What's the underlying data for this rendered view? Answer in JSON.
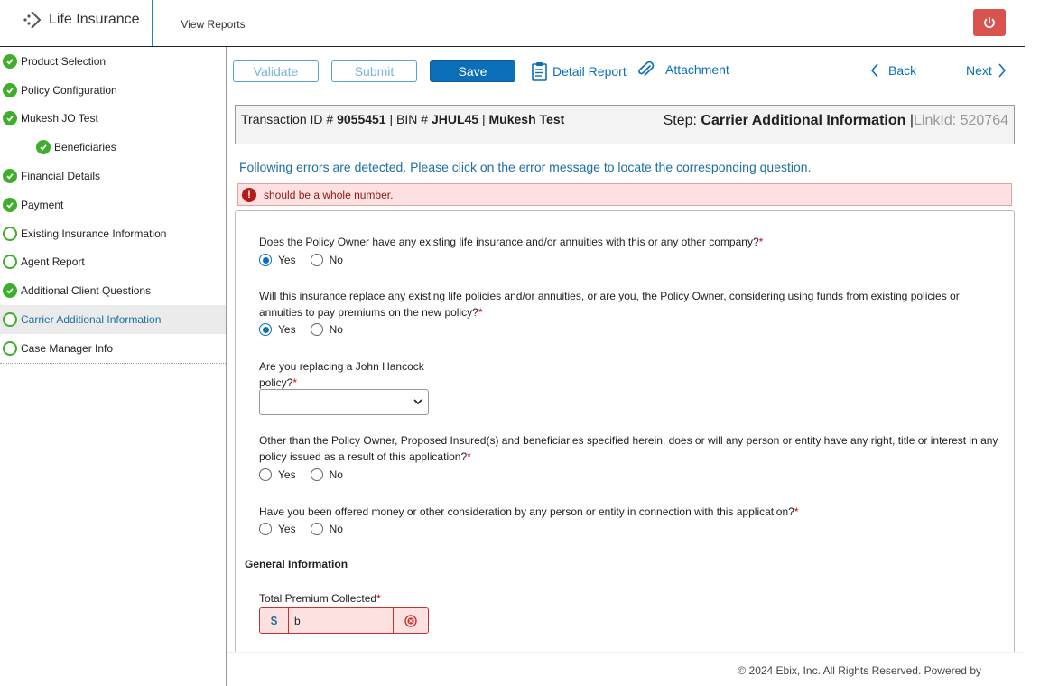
{
  "header": {
    "app_name": "Life Insurance",
    "view_reports": "View Reports",
    "power_icon": "power-icon",
    "accent_color": "#d9534f"
  },
  "sidebar": {
    "items": [
      {
        "label": "Product Selection",
        "status": "done"
      },
      {
        "label": "Policy Configuration",
        "status": "done"
      },
      {
        "label": "Mukesh JO Test",
        "status": "done"
      },
      {
        "label": "Beneficiaries",
        "status": "done",
        "sub": true
      },
      {
        "label": "Financial Details",
        "status": "done"
      },
      {
        "label": "Payment",
        "status": "done"
      },
      {
        "label": "Existing Insurance Information",
        "status": "pending"
      },
      {
        "label": "Agent Report",
        "status": "pending"
      },
      {
        "label": "Additional Client Questions",
        "status": "done"
      },
      {
        "label": "Carrier Additional Information",
        "status": "pending",
        "active": true
      },
      {
        "label": "Case Manager Info",
        "status": "pending"
      }
    ]
  },
  "toolbar": {
    "validate": "Validate",
    "submit": "Submit",
    "save": "Save",
    "detail_report": "Detail Report",
    "attachment": "Attachment",
    "back": "Back",
    "next": "Next"
  },
  "transaction": {
    "id_label": "Transaction ID #",
    "id": "9055451",
    "bin_label": "| BIN #",
    "bin": "JHUL45",
    "sep": "|",
    "name": "Mukesh Test",
    "step_label": "Step:",
    "step": "Carrier Additional Information",
    "step_sep": "|",
    "linkid": "LinkId: 520764"
  },
  "errors": {
    "intro": "Following errors are detected. Please click on the error message to locate the corresponding question.",
    "message": "should be a whole number."
  },
  "form": {
    "q1": "Does the Policy Owner have any existing life insurance and/or annuities with this or any other company?",
    "q2": "Will this insurance replace any existing life policies and/or annuities, or are you, the Policy Owner, considering using funds from existing policies or annuities to pay premiums on the new policy?",
    "q3_line1": "Are you replacing a John Hancock",
    "q3_line2": "policy?",
    "q4": "Other than the Policy Owner, Proposed Insured(s) and beneficiaries specified herein, does or will any person or entity have any right, title or interest in any policy issued as a result of this application?",
    "q5": "Have you been offered money or other consideration by any person or entity in connection with this application?",
    "yes": "Yes",
    "no": "No",
    "required_mark": "*",
    "section_general": "General Information",
    "premium_label": "Total Premium Collected",
    "currency": "$",
    "premium_value": "b",
    "q3_selected": ""
  },
  "footer": {
    "copyright": "© 2024 Ebix, Inc. All Rights Reserved. Powered by"
  }
}
